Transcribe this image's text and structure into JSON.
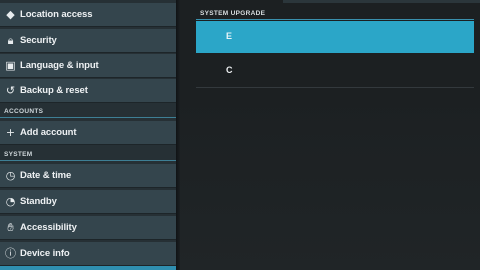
{
  "sidebar": {
    "items_top": [
      {
        "label": "Location access",
        "icon": "location-icon"
      },
      {
        "label": "Security",
        "icon": "lock-icon"
      },
      {
        "label": "Language & input",
        "icon": "keyboard-icon"
      },
      {
        "label": "Backup & reset",
        "icon": "restore-icon"
      }
    ],
    "accounts_header": "ACCOUNTS",
    "add_account": {
      "label": "Add account",
      "icon": "plus-icon"
    },
    "system_header": "SYSTEM",
    "items_system": [
      {
        "label": "Date & time",
        "icon": "clock-icon"
      },
      {
        "label": "Standby",
        "icon": "standby-icon"
      },
      {
        "label": "Accessibility",
        "icon": "hand-icon"
      },
      {
        "label": "Device info",
        "icon": "info-icon"
      }
    ]
  },
  "main": {
    "section_header": "SYSTEM UPGRADE",
    "options": [
      {
        "label": "E",
        "selected": true
      },
      {
        "label": "C",
        "selected": false
      }
    ]
  },
  "colors": {
    "accent": "#2ba6c8",
    "sidebar_item": "#34454d",
    "background": "#1c2022"
  }
}
